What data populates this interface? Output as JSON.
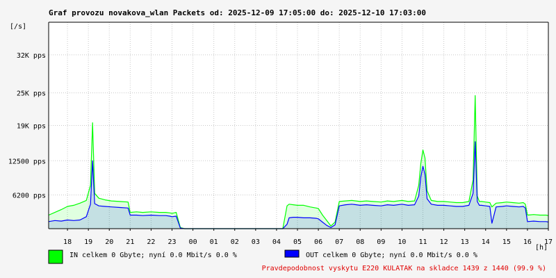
{
  "chart_data": {
    "type": "line",
    "title": "Graf provozu novakova_wlan Packets od: 2025-12-09 17:05:00 do: 2025-12-10 17:03:00",
    "ylabel": "[/s]",
    "xlabel": "[h]",
    "ylim": [
      0,
      38000
    ],
    "xlim": [
      17.1,
      41.0
    ],
    "grid": true,
    "y_ticks": [
      {
        "value": 6200,
        "label": "6200 pps"
      },
      {
        "value": 12500,
        "label": "12500 pps"
      },
      {
        "value": 19000,
        "label": "19K pps"
      },
      {
        "value": 25000,
        "label": "25K pps"
      },
      {
        "value": 32000,
        "label": "32K pps"
      }
    ],
    "x_ticks": [
      {
        "value": 18,
        "label": "18"
      },
      {
        "value": 19,
        "label": "19"
      },
      {
        "value": 20,
        "label": "20"
      },
      {
        "value": 21,
        "label": "21"
      },
      {
        "value": 22,
        "label": "22"
      },
      {
        "value": 23,
        "label": "23"
      },
      {
        "value": 24,
        "label": "00"
      },
      {
        "value": 25,
        "label": "01"
      },
      {
        "value": 26,
        "label": "02"
      },
      {
        "value": 27,
        "label": "03"
      },
      {
        "value": 28,
        "label": "04"
      },
      {
        "value": 29,
        "label": "05"
      },
      {
        "value": 30,
        "label": "06"
      },
      {
        "value": 31,
        "label": "07"
      },
      {
        "value": 32,
        "label": "08"
      },
      {
        "value": 33,
        "label": "09"
      },
      {
        "value": 34,
        "label": "10"
      },
      {
        "value": 35,
        "label": "11"
      },
      {
        "value": 36,
        "label": "12"
      },
      {
        "value": 37,
        "label": "13"
      },
      {
        "value": 38,
        "label": "14"
      },
      {
        "value": 39,
        "label": "15"
      },
      {
        "value": 40,
        "label": "16"
      },
      {
        "value": 41,
        "label": "17"
      }
    ],
    "series": [
      {
        "key": "in",
        "color": "#00ff00",
        "x": [
          17.1,
          17.4,
          17.7,
          18.0,
          18.3,
          18.6,
          18.9,
          19.1,
          19.2,
          19.3,
          19.5,
          19.8,
          20.1,
          20.5,
          20.9,
          21.0,
          21.3,
          21.6,
          22.0,
          22.4,
          22.7,
          22.9,
          23.0,
          23.2,
          23.4,
          23.5,
          23.6,
          23.8,
          24.0,
          24.2,
          24.5,
          25.0,
          25.5,
          26.0,
          26.5,
          27.0,
          27.5,
          28.0,
          28.3,
          28.5,
          28.6,
          28.8,
          29.0,
          29.3,
          29.6,
          29.9,
          30.0,
          30.2,
          30.4,
          30.6,
          30.8,
          31.0,
          31.3,
          31.6,
          32.0,
          32.3,
          32.6,
          33.0,
          33.3,
          33.6,
          34.0,
          34.3,
          34.6,
          34.8,
          34.9,
          35.0,
          35.1,
          35.2,
          35.4,
          35.7,
          36.0,
          36.3,
          36.6,
          36.9,
          37.2,
          37.4,
          37.5,
          37.6,
          37.7,
          37.8,
          38.0,
          38.2,
          38.3,
          38.5,
          38.8,
          39.0,
          39.3,
          39.6,
          39.8,
          39.9,
          40.0,
          40.3,
          40.6,
          40.9,
          41.0
        ],
        "values": [
          2500,
          3000,
          3500,
          4100,
          4300,
          4700,
          5200,
          8000,
          19500,
          6500,
          5600,
          5300,
          5100,
          5000,
          4900,
          3000,
          3100,
          3000,
          3100,
          3000,
          3000,
          2900,
          2800,
          3000,
          200,
          100,
          0,
          0,
          0,
          0,
          0,
          0,
          0,
          0,
          0,
          0,
          0,
          0,
          0,
          4200,
          4500,
          4400,
          4300,
          4300,
          4000,
          3800,
          3700,
          2500,
          1500,
          500,
          1200,
          5000,
          5100,
          5200,
          5000,
          5100,
          5000,
          4900,
          5100,
          5000,
          5200,
          5000,
          5100,
          8000,
          12000,
          14500,
          13000,
          7000,
          5200,
          5000,
          5000,
          4900,
          4800,
          4800,
          5000,
          9000,
          24500,
          6000,
          5000,
          5000,
          4900,
          4800,
          4000,
          4700,
          4800,
          4900,
          4800,
          4700,
          4800,
          4500,
          2500,
          2600,
          2500,
          2500,
          2400
        ]
      },
      {
        "key": "out",
        "color": "#0000ff",
        "x": [
          17.1,
          17.4,
          17.7,
          18.0,
          18.3,
          18.6,
          18.9,
          19.1,
          19.2,
          19.3,
          19.5,
          19.8,
          20.1,
          20.5,
          20.9,
          21.0,
          21.3,
          21.6,
          22.0,
          22.4,
          22.7,
          22.9,
          23.0,
          23.2,
          23.4,
          23.5,
          23.6,
          23.8,
          24.0,
          24.2,
          24.5,
          25.0,
          25.5,
          26.0,
          26.5,
          27.0,
          27.5,
          28.0,
          28.3,
          28.5,
          28.6,
          28.8,
          29.0,
          29.3,
          29.6,
          29.9,
          30.0,
          30.2,
          30.4,
          30.6,
          30.8,
          31.0,
          31.3,
          31.6,
          32.0,
          32.3,
          32.6,
          33.0,
          33.3,
          33.6,
          34.0,
          34.3,
          34.6,
          34.8,
          34.9,
          35.0,
          35.1,
          35.2,
          35.4,
          35.7,
          36.0,
          36.3,
          36.6,
          36.9,
          37.2,
          37.4,
          37.5,
          37.6,
          37.7,
          37.8,
          38.0,
          38.2,
          38.3,
          38.5,
          38.8,
          39.0,
          39.3,
          39.6,
          39.8,
          39.9,
          40.0,
          40.3,
          40.6,
          40.9,
          41.0
        ],
        "values": [
          1300,
          1500,
          1400,
          1600,
          1500,
          1600,
          2200,
          4500,
          12500,
          4600,
          4200,
          4100,
          4000,
          3900,
          3800,
          2500,
          2500,
          2400,
          2500,
          2400,
          2400,
          2300,
          2200,
          2300,
          100,
          50,
          0,
          0,
          0,
          0,
          0,
          0,
          0,
          0,
          0,
          0,
          0,
          0,
          0,
          800,
          2000,
          2100,
          2100,
          2000,
          2000,
          1900,
          1800,
          1200,
          600,
          200,
          700,
          4200,
          4400,
          4500,
          4300,
          4400,
          4300,
          4200,
          4400,
          4300,
          4500,
          4300,
          4400,
          6000,
          9500,
          11500,
          10000,
          5500,
          4500,
          4300,
          4300,
          4200,
          4100,
          4100,
          4300,
          6500,
          16000,
          5000,
          4300,
          4300,
          4200,
          4100,
          1000,
          4000,
          4100,
          4200,
          4100,
          4000,
          4100,
          3800,
          1300,
          1400,
          1300,
          1300,
          1200
        ]
      }
    ]
  },
  "legend": {
    "in_label": "IN celkem 0 Gbyte; nyní    0.0 Mbit/s 0.0 %",
    "out_label": "OUT celkem 0 Gbyte; nyní    0.0 Mbit/s 0.0 %",
    "in_color": "#00ff00",
    "out_color": "#0000ff"
  },
  "note": "Pravdepodobnost vyskytu E220 KULATAK na skladce 1439 z 1440 (99.9 %)",
  "colors": {
    "background": "#f5f5f5",
    "plot_background": "#ffffff",
    "note_text": "#e00000"
  }
}
